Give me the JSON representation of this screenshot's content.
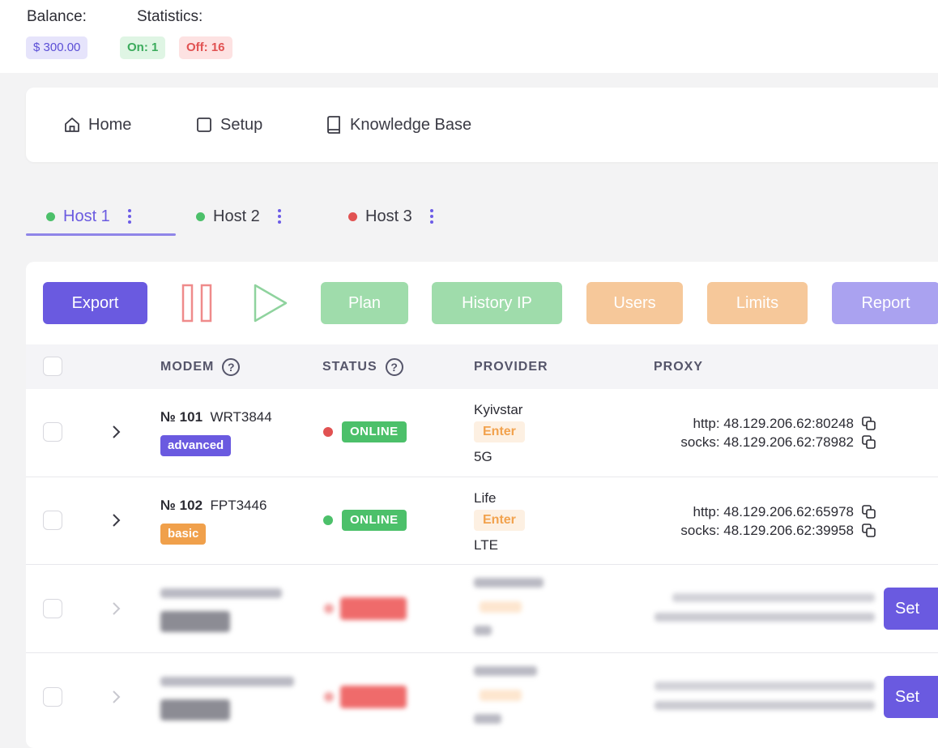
{
  "header": {
    "balance_label": "Balance:",
    "statistics_label": "Statistics:",
    "balance_value": "$ 300.00",
    "on_count": "On: 1",
    "off_count": "Off: 16"
  },
  "nav": {
    "items": [
      {
        "label": "Home",
        "icon": "home-icon"
      },
      {
        "label": "Setup",
        "icon": "square-icon"
      },
      {
        "label": "Knowledge Base",
        "icon": "book-icon"
      }
    ]
  },
  "hosts": [
    {
      "label": "Host 1",
      "status_color": "#4cc06a",
      "active": true
    },
    {
      "label": "Host 2",
      "status_color": "#4cc06a",
      "active": false
    },
    {
      "label": "Host 3",
      "status_color": "#e15252",
      "active": false
    }
  ],
  "toolbar": {
    "export": "Export",
    "plan": "Plan",
    "history_ip": "History IP",
    "users": "Users",
    "limits": "Limits",
    "report": "Report"
  },
  "table": {
    "columns": {
      "modem": "MODEM",
      "status": "STATUS",
      "provider": "PROVIDER",
      "proxy": "PROXY",
      "help_glyph": "?"
    },
    "rows": [
      {
        "number": "№ 101",
        "model": "WRT3844",
        "plan": "advanced",
        "status": "ONLINE",
        "status_color": "#e15252",
        "provider": "Kyivstar",
        "enter": "Enter",
        "network": "5G",
        "http": "http: 48.129.206.62:80248",
        "socks": "socks: 48.129.206.62:78982"
      },
      {
        "number": "№ 102",
        "model": "FPT3446",
        "plan": "basic",
        "status": "ONLINE",
        "status_color": "#4cc06a",
        "provider": "Life",
        "enter": "Enter",
        "network": "LTE",
        "http": "http: 48.129.206.62:65978",
        "socks": "socks: 48.129.206.62:39958"
      }
    ],
    "set_label": "Set"
  },
  "colors": {
    "accent": "#6a5ae0",
    "online": "#4cc06a",
    "offline": "#e15252",
    "orange": "#f0a04b"
  }
}
